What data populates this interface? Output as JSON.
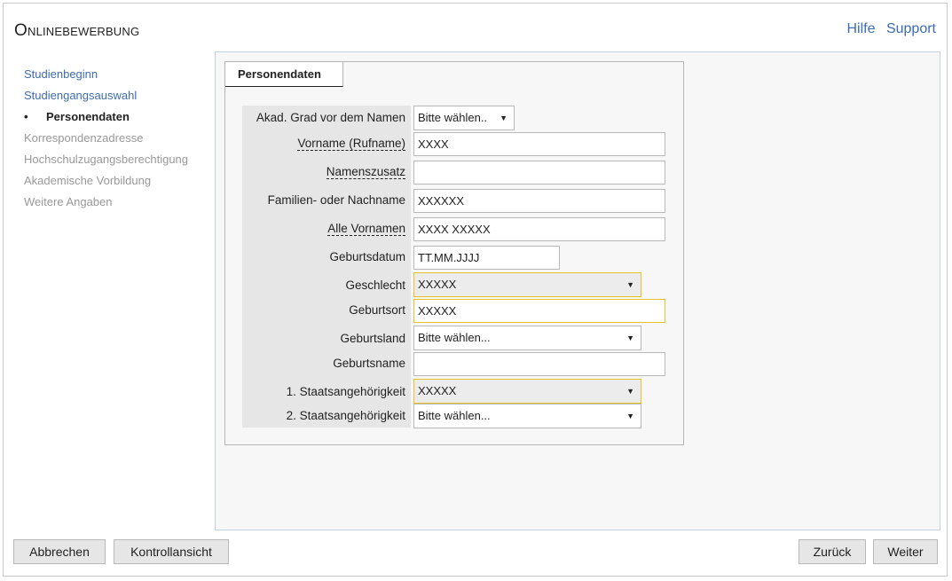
{
  "app": {
    "title": "Onlinebewerbung"
  },
  "toplinks": {
    "help": "Hilfe",
    "support": "Support"
  },
  "nav": [
    {
      "label": "Studienbeginn",
      "state": "link"
    },
    {
      "label": "Studiengangsauswahl",
      "state": "link"
    },
    {
      "label": "Personendaten",
      "state": "active"
    },
    {
      "label": "Korrespondenzadresse",
      "state": "disabled"
    },
    {
      "label": "Hochschulzugangsberechtigung",
      "state": "disabled"
    },
    {
      "label": "Akademische Vorbildung",
      "state": "disabled"
    },
    {
      "label": "Weitere Angaben",
      "state": "disabled"
    }
  ],
  "panel": {
    "tab": "Personendaten"
  },
  "form": [
    {
      "label": "Akad. Grad vor dem Namen",
      "type": "select",
      "value": "Bitte wählen..",
      "dotted": false
    },
    {
      "label": "Vorname (Rufname)",
      "type": "input",
      "value": "XXXX",
      "dotted": true
    },
    {
      "label": "Namenszusatz",
      "type": "input",
      "value": "",
      "dotted": true
    },
    {
      "label": "Familien- oder Nachname",
      "type": "input",
      "value": "XXXXXX",
      "dotted": false
    },
    {
      "label": "Alle Vornamen",
      "type": "input",
      "value": "XXXX XXXXX",
      "dotted": true
    },
    {
      "label": "Geburtsdatum",
      "type": "input",
      "value": "TT.MM.JJJJ",
      "dotted": false
    },
    {
      "label": "Geschlecht",
      "type": "select",
      "value": "XXXXX",
      "dotted": false
    },
    {
      "label": "Geburtsort",
      "type": "input",
      "value": "XXXXX",
      "dotted": false
    },
    {
      "label": "Geburtsland",
      "type": "select",
      "value": "Bitte wählen...",
      "dotted": false
    },
    {
      "label": "Geburtsname",
      "type": "input",
      "value": "",
      "dotted": false
    },
    {
      "label": "1. Staatsangehörigkeit",
      "type": "select",
      "value": "XXXXX",
      "dotted": false
    },
    {
      "label": "2. Staatsangehörigkeit",
      "type": "select",
      "value": "Bitte wählen...",
      "dotted": false
    }
  ],
  "buttons": {
    "cancel": "Abbrechen",
    "review": "Kontrollansicht",
    "back": "Zurück",
    "next": "Weiter"
  },
  "colors": {
    "link": "#3d6db3",
    "highlight": "#e8c229"
  }
}
